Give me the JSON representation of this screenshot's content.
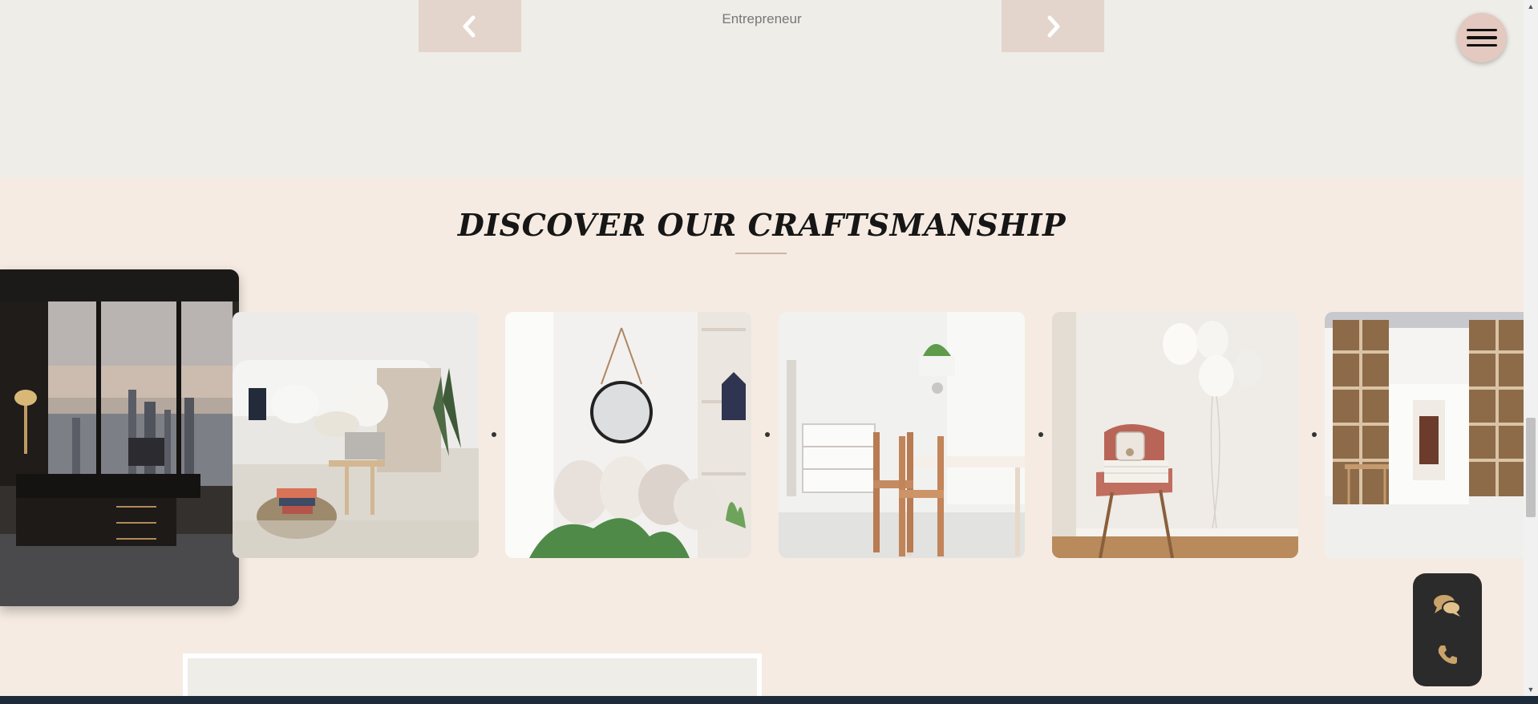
{
  "testimonial": {
    "role": "Entrepreneur",
    "prev_icon": "chevron-left-icon",
    "next_icon": "chevron-right-icon"
  },
  "menu": {
    "icon": "hamburger-menu-icon"
  },
  "craftsmanship": {
    "title": "DISCOVER OUR CRAFTSMANSHIP",
    "tiles": [
      {
        "name": "executive-office"
      },
      {
        "name": "cozy-sofa-nook"
      },
      {
        "name": "mirror-cushions-corner"
      },
      {
        "name": "white-dining-room"
      },
      {
        "name": "pink-chair-balloons"
      },
      {
        "name": "bookshelf-loft"
      }
    ]
  },
  "contact": {
    "chat_icon": "chat-bubbles-icon",
    "phone_icon": "phone-icon"
  },
  "colors": {
    "accent": "#e3d5cc",
    "craft_bg": "#f5ebe2",
    "page_bg": "#eeede8",
    "widget_bg": "#2b2b2b",
    "icon_gold": "#c9a36a"
  }
}
